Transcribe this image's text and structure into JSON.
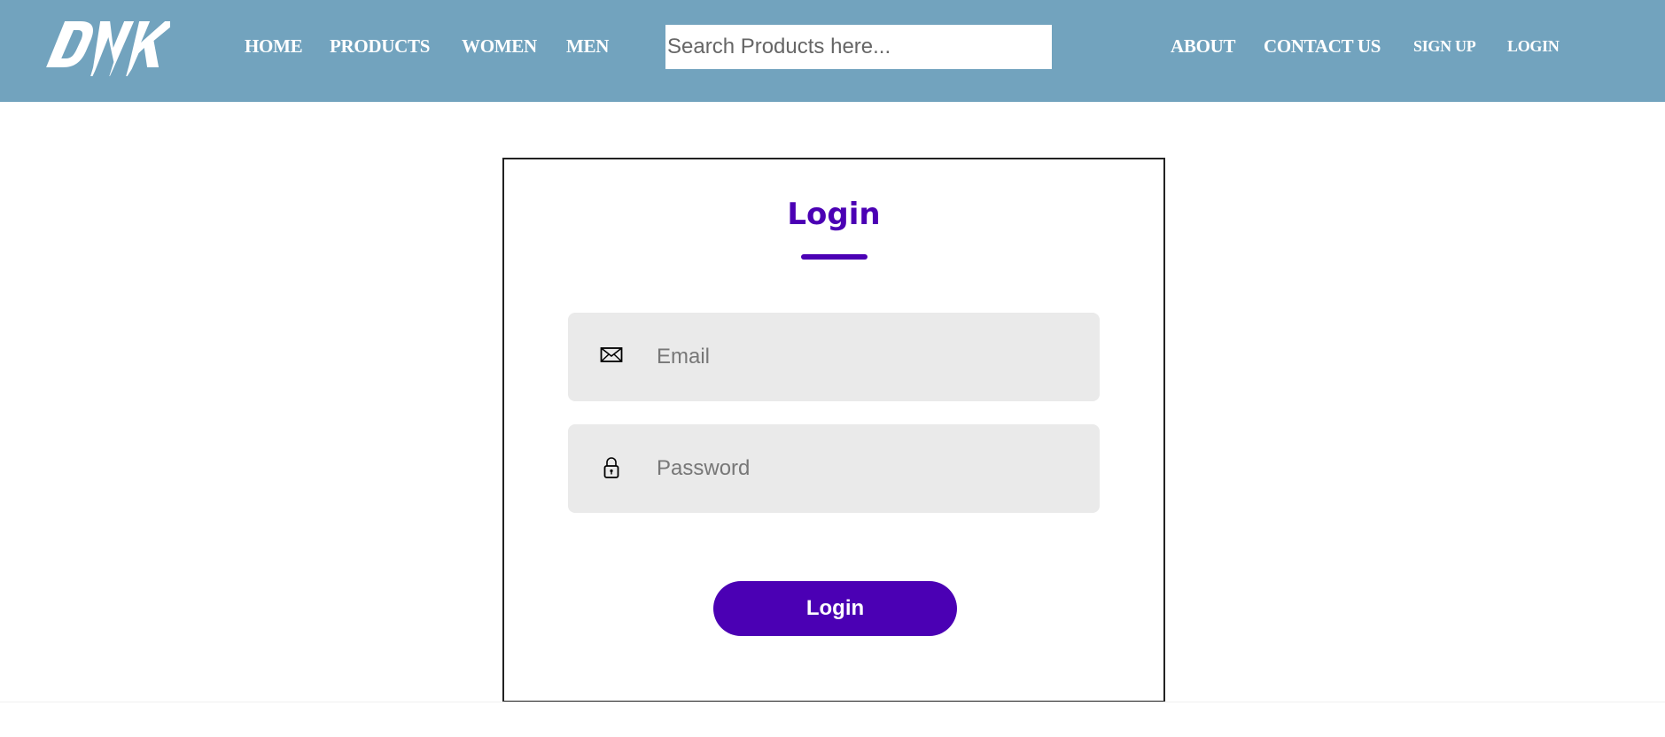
{
  "header": {
    "logo_text": "DNK",
    "nav_left": [
      "HOME",
      "PRODUCTS",
      "WOMEN",
      "MEN"
    ],
    "search_placeholder": "Search Products here...",
    "nav_right": [
      "ABOUT",
      "CONTACT US",
      "SIGN UP",
      "LOGIN"
    ],
    "background": "#72a3be"
  },
  "login": {
    "title": "Login",
    "email_placeholder": "Email",
    "email_icon": "envelope-icon",
    "password_placeholder": "Password",
    "password_icon": "lock-icon",
    "submit_label": "Login",
    "accent": "#4b00b4"
  }
}
